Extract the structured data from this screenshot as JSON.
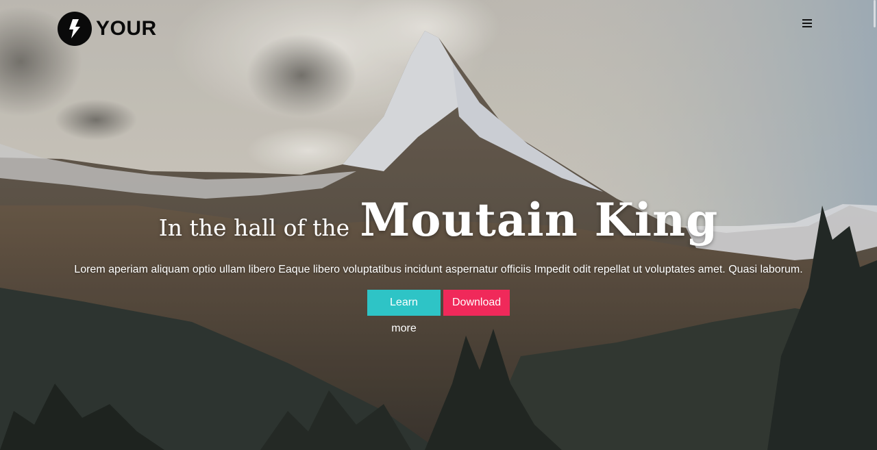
{
  "brand": {
    "name": "YOUR",
    "logo_icon": "lightning-bolt-icon"
  },
  "nav": {
    "menu_icon": "hamburger-menu-icon"
  },
  "hero": {
    "headline_small": "In the hall of the",
    "headline_big": "Moutain King",
    "lead": "Lorem aperiam aliquam optio ullam libero Eaque libero voluptatibus incidunt aspernatur officiis Impedit odit repellat ut voluptates amet. Quasi laborum.",
    "background": "mountain-landscape-photo"
  },
  "buttons": {
    "learn_more": "Learn more",
    "download": "Download"
  },
  "colors": {
    "learn_more_bg": "#2ec4c6",
    "download_bg": "#f0295a",
    "logo": "#0a0a0a"
  }
}
